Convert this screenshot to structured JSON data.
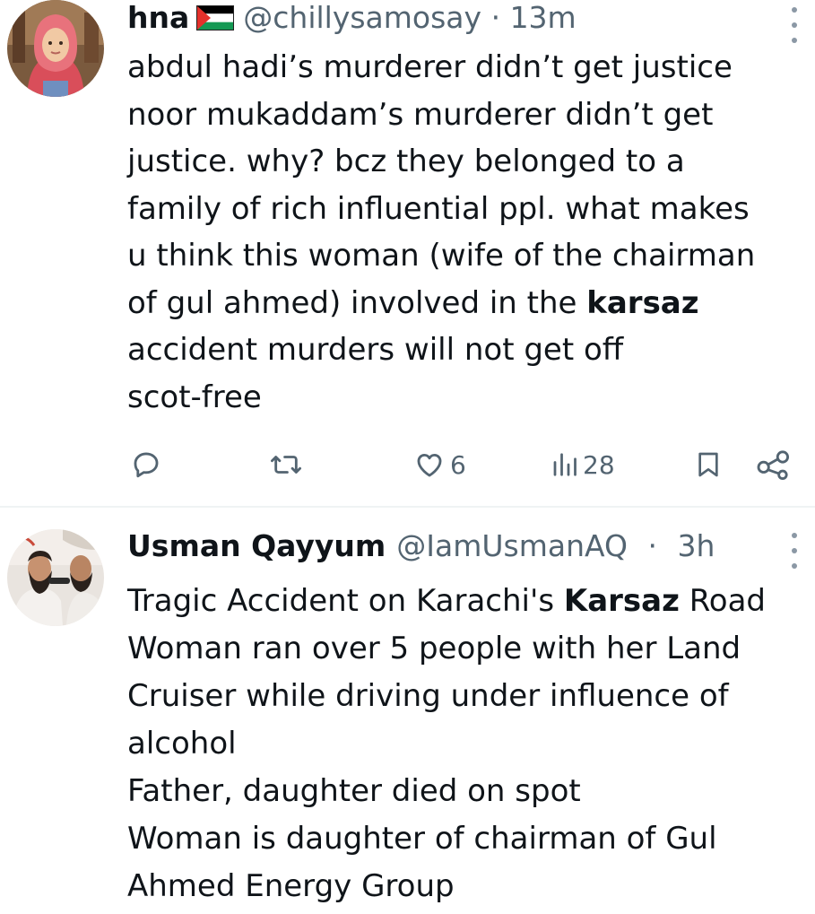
{
  "tweets": [
    {
      "display_name": "hna",
      "handle": "@chillysamosay",
      "separator": "·",
      "time": "13m",
      "flag_icon": "palestine-flag-icon",
      "body_lines": [
        [
          "abdul hadi’s murderer didn’t get justice"
        ],
        [
          "noor mukaddam’s murderer didn’t get"
        ],
        [
          "justice. why? bcz they belonged to a"
        ],
        [
          "family of rich influential ppl. what makes"
        ],
        [
          "u think this woman (wife of the chairman"
        ],
        [
          "of gul ahmed) involved in the ",
          "karsaz"
        ],
        [
          "accident murders will not get off"
        ],
        [
          "scot-free"
        ]
      ],
      "actions": {
        "reply_icon": "reply-icon",
        "retweet_icon": "retweet-icon",
        "like_icon": "heart-icon",
        "like_count": "6",
        "views_icon": "views-icon",
        "views_count": "28",
        "bookmark_icon": "bookmark-icon",
        "share_icon": "share-icon"
      }
    },
    {
      "display_name": "Usman Qayyum",
      "handle": "@IamUsmanAQ",
      "separator": "·",
      "time": "3h",
      "body_lines": [
        [
          "Tragic Accident on Karachi's ",
          "Karsaz",
          " Road"
        ],
        [
          "Woman ran over 5 people with her Land"
        ],
        [
          "Cruiser while driving under influence of"
        ],
        [
          "alcohol"
        ],
        [
          "Father, daughter died on spot"
        ],
        [
          "Woman is daughter of chairman of Gul"
        ],
        [
          "Ahmed Energy Group"
        ]
      ]
    }
  ],
  "colors": {
    "text": "#0f1419",
    "secondary": "#536471",
    "divider": "#eff3f4"
  }
}
